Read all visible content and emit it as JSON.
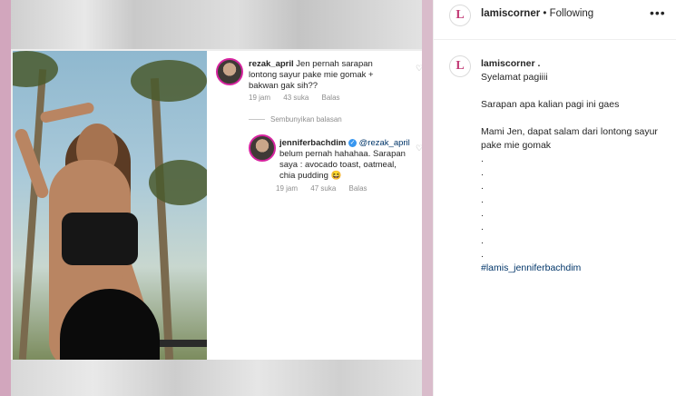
{
  "comments": [
    {
      "username": "rezak_april",
      "text": "Jen pernah sarapan lontong sayur pake mie gomak + bakwan gak sih??",
      "time": "19 jam",
      "likes": "43 suka",
      "reply": "Balas"
    },
    {
      "hide_replies": "Sembunyikan balasan"
    },
    {
      "username": "jenniferbachdim",
      "verified": "✓",
      "mention": "@rezak_april",
      "text": "belum pernah hahahaa. Sarapan saya : avocado toast, oatmeal, chia pudding 😆",
      "time": "19 jam",
      "likes": "47 suka",
      "reply": "Balas"
    }
  ],
  "header": {
    "username": "lamiscorner",
    "separator": " • ",
    "following": "Following",
    "more": "•••",
    "logo_letter": "L"
  },
  "caption": {
    "username": "lamiscorner .",
    "lines": [
      "Syelamat pagiiii",
      "",
      "Sarapan apa kalian pagi ini gaes",
      "",
      "Mami Jen, dapat salam dari lontong sayur pake mie gomak",
      ".",
      ".",
      ".",
      ".",
      ".",
      ".",
      ".",
      "."
    ],
    "hashtag": "#lamis_jenniferbachdim"
  },
  "icons": {
    "heart": "♡"
  },
  "colors": {
    "accent_link": "#003569",
    "verified_blue": "#3897f0",
    "background": "#d9bccb",
    "logo_pink": "#c23b76"
  }
}
